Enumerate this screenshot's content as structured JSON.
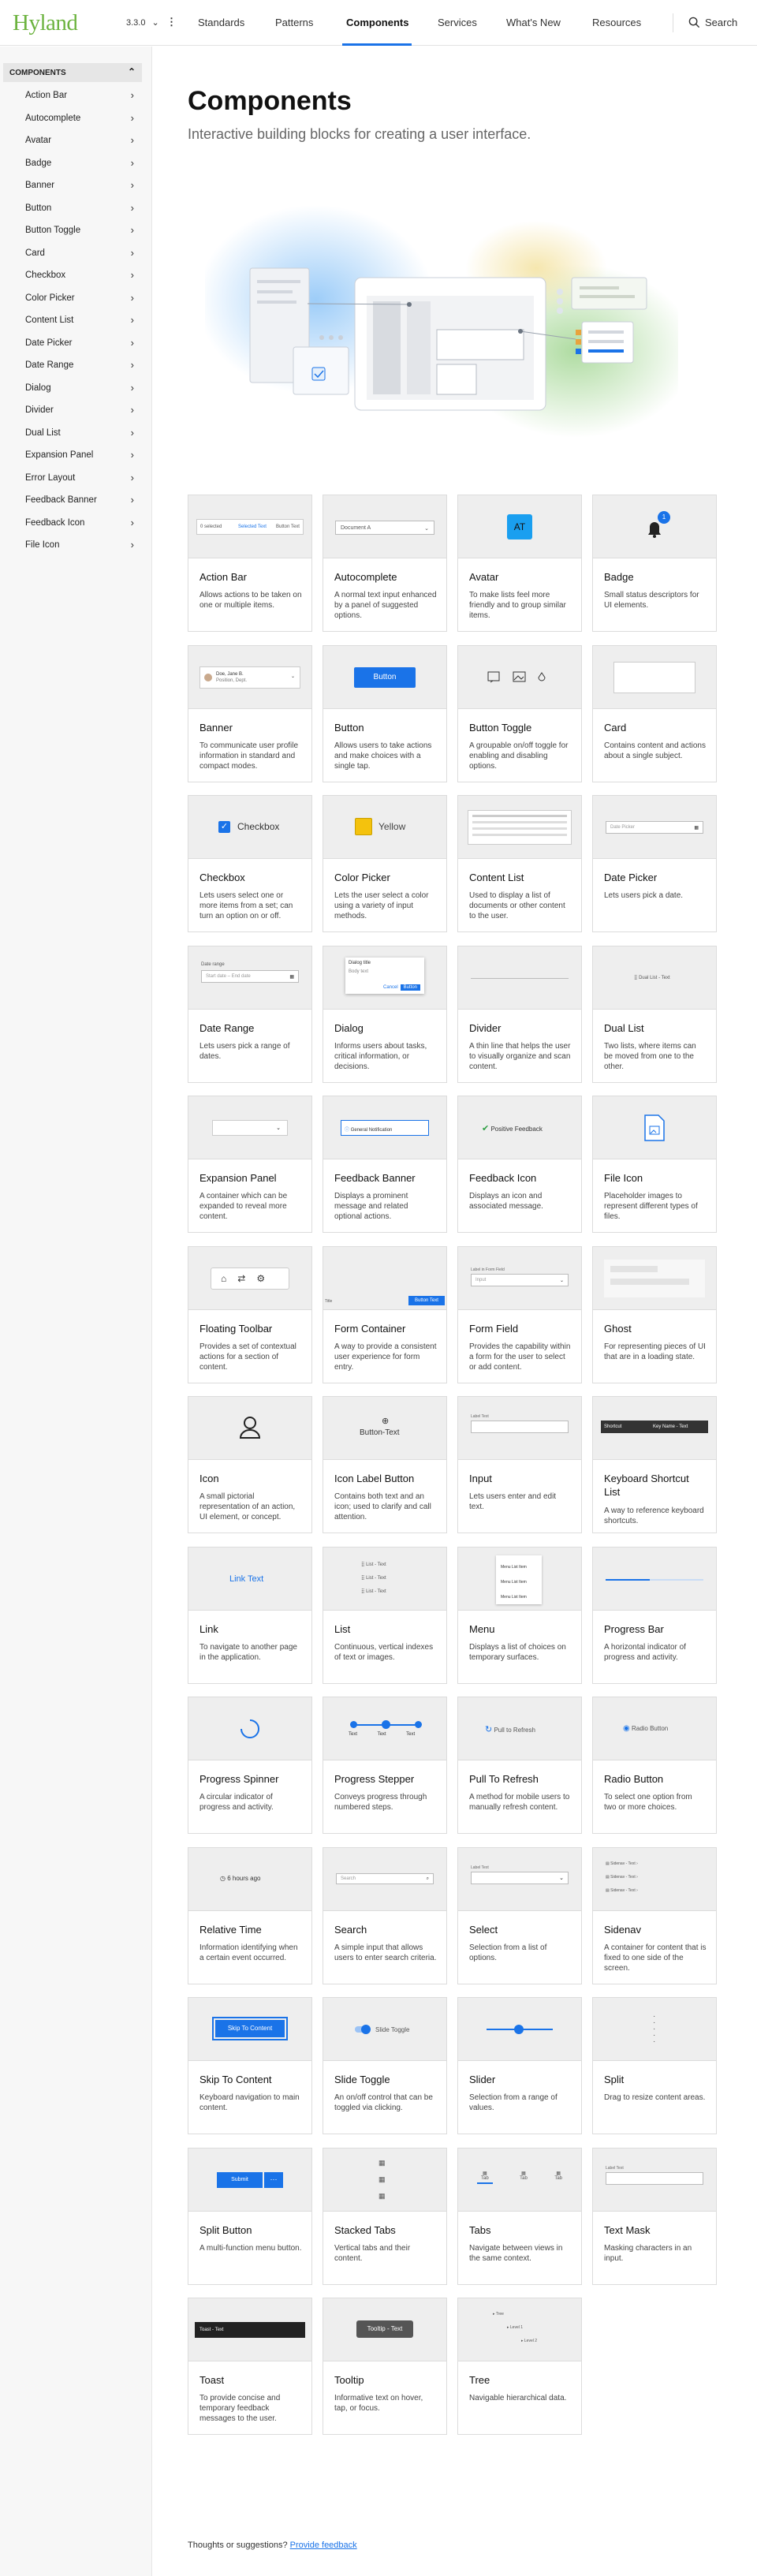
{
  "header": {
    "logo": "Hyland",
    "version": "3.3.0",
    "kebab": "⋮",
    "nav": [
      "Standards",
      "Patterns",
      "Components",
      "Services",
      "What's New",
      "Resources"
    ],
    "search_label": "Search"
  },
  "sidebar": {
    "heading": "COMPONENTS",
    "items": [
      "Action Bar",
      "Autocomplete",
      "Avatar",
      "Badge",
      "Banner",
      "Button",
      "Button Toggle",
      "Card",
      "Checkbox",
      "Color Picker",
      "Content List",
      "Date Picker",
      "Date Range",
      "Dialog",
      "Divider",
      "Dual List",
      "Expansion Panel",
      "Error Layout",
      "Feedback Banner",
      "Feedback Icon",
      "File Icon"
    ]
  },
  "page": {
    "title": "Components",
    "subtitle": "Interactive building blocks for creating a user interface."
  },
  "cards": [
    {
      "title": "Action Bar",
      "desc": "Allows actions to be taken on one or multiple items."
    },
    {
      "title": "Autocomplete",
      "desc": "A normal text input enhanced by a panel of suggested options."
    },
    {
      "title": "Avatar",
      "desc": "To make lists feel more friendly and to group similar items."
    },
    {
      "title": "Badge",
      "desc": "Small status descriptors for UI elements."
    },
    {
      "title": "Banner",
      "desc": "To communicate user profile information in standard and compact modes."
    },
    {
      "title": "Button",
      "desc": "Allows users to take actions and make choices with a single tap."
    },
    {
      "title": "Button Toggle",
      "desc": "A groupable on/off toggle for enabling and disabling options."
    },
    {
      "title": "Card",
      "desc": "Contains content and actions about a single subject."
    },
    {
      "title": "Checkbox",
      "desc": "Lets users select one or more items from a set; can turn an option on or off."
    },
    {
      "title": "Color Picker",
      "desc": "Lets the user select a color using a variety of input methods."
    },
    {
      "title": "Content List",
      "desc": "Used to display a list of documents or other content to the user."
    },
    {
      "title": "Date Picker",
      "desc": "Lets users pick a date."
    },
    {
      "title": "Date Range",
      "desc": "Lets users pick a range of dates."
    },
    {
      "title": "Dialog",
      "desc": "Informs users about tasks, critical information, or decisions."
    },
    {
      "title": "Divider",
      "desc": "A thin line that helps the user to visually organize and scan content."
    },
    {
      "title": "Dual List",
      "desc": "Two lists, where items can be moved from one to the other."
    },
    {
      "title": "Expansion Panel",
      "desc": "A container which can be expanded to reveal more content."
    },
    {
      "title": "Feedback Banner",
      "desc": "Displays a prominent message and related optional actions."
    },
    {
      "title": "Feedback Icon",
      "desc": "Displays an icon and associated message."
    },
    {
      "title": "File Icon",
      "desc": "Placeholder images to represent different types of files."
    },
    {
      "title": "Floating Toolbar",
      "desc": "Provides a set of contextual actions for a section of content."
    },
    {
      "title": "Form Container",
      "desc": "A way to provide a consistent user experience for form entry."
    },
    {
      "title": "Form Field",
      "desc": "Provides the capability within a form for the user to select or add content."
    },
    {
      "title": "Ghost",
      "desc": "For representing pieces of UI that are in a loading state."
    },
    {
      "title": "Icon",
      "desc": "A small pictorial representation of an action, UI element, or concept."
    },
    {
      "title": "Icon Label Button",
      "desc": "Contains both text and an icon; used to clarify and call attention."
    },
    {
      "title": "Input",
      "desc": "Lets users enter and edit text."
    },
    {
      "title": "Keyboard Shortcut List",
      "desc": "A way to reference keyboard shortcuts."
    },
    {
      "title": "Link",
      "desc": "To navigate to another page in the application."
    },
    {
      "title": "List",
      "desc": "Continuous, vertical indexes of text or images."
    },
    {
      "title": "Menu",
      "desc": "Displays a list of choices on temporary surfaces."
    },
    {
      "title": "Progress Bar",
      "desc": "A horizontal indicator of progress and activity."
    },
    {
      "title": "Progress Spinner",
      "desc": "A circular indicator of progress and activity."
    },
    {
      "title": "Progress Stepper",
      "desc": "Conveys progress through numbered steps."
    },
    {
      "title": "Pull To Refresh",
      "desc": "A method for mobile users to manually refresh content."
    },
    {
      "title": "Radio Button",
      "desc": "To select one option from two or more choices."
    },
    {
      "title": "Relative Time",
      "desc": "Information identifying when a certain event occurred."
    },
    {
      "title": "Search",
      "desc": "A simple input that allows users to enter search criteria."
    },
    {
      "title": "Select",
      "desc": "Selection from a list of options."
    },
    {
      "title": "Sidenav",
      "desc": "A container for content that is fixed to one side of the screen."
    },
    {
      "title": "Skip To Content",
      "desc": "Keyboard navigation to main content."
    },
    {
      "title": "Slide Toggle",
      "desc": "An on/off control that can be toggled via clicking."
    },
    {
      "title": "Slider",
      "desc": "Selection from a range of values."
    },
    {
      "title": "Split",
      "desc": "Drag to resize content areas."
    },
    {
      "title": "Split Button",
      "desc": "A multi-function menu button."
    },
    {
      "title": "Stacked Tabs",
      "desc": "Vertical tabs and their content."
    },
    {
      "title": "Tabs",
      "desc": "Navigate between views in the same context."
    },
    {
      "title": "Text Mask",
      "desc": "Masking characters in an input."
    },
    {
      "title": "Toast",
      "desc": "To provide concise and temporary feedback messages to the user."
    },
    {
      "title": "Tooltip",
      "desc": "Informative text on hover, tap, or focus."
    },
    {
      "title": "Tree",
      "desc": "Navigable hierarchical data."
    }
  ],
  "previews": {
    "action_bar": [
      "0 selected",
      "Selected Text",
      "Button Text"
    ],
    "autocomplete": "Document A",
    "avatar": "AT",
    "badge": "1",
    "banner": [
      "Doe, Jane B.",
      "Position, Dept."
    ],
    "button": "Button",
    "checkbox": "Checkbox",
    "color_picker": "Yellow",
    "date_picker": "Date Picker",
    "date_range": [
      "Date range",
      "Start date – End date"
    ],
    "dialog": [
      "Dialog title",
      "Body text",
      "Cancel",
      "Button"
    ],
    "dual_list": "Dual List - Text",
    "feedback_banner": "General Notification",
    "feedback_icon": "Positive Feedback",
    "form_container": [
      "Title",
      "Button Text"
    ],
    "form_field": [
      "Label in Form Field",
      "Input"
    ],
    "icon_label_button": "Button-Text",
    "input": "Label Text",
    "kbd": [
      "Shortcut",
      "Key Name - Text"
    ],
    "link": "Link Text",
    "list": [
      "List - Text",
      "List - Text",
      "List - Text"
    ],
    "menu": [
      "Menu List Item",
      "Menu List Item",
      "Menu List Item"
    ],
    "stepper": [
      "Text",
      "Text",
      "Text"
    ],
    "pull": "Pull to Refresh",
    "radio": "Radio Button",
    "relative_time": "6 hours ago",
    "search": "Search",
    "select": "Label Text",
    "sidenav": [
      "Sidenav - Text",
      "Sidenav - Text",
      "Sidenav - Text"
    ],
    "skip": "Skip To Content",
    "slide_toggle": "Slide Toggle",
    "split_button": "Submit",
    "tabs": [
      "Tab",
      "Tab",
      "Tab"
    ],
    "text_mask": "Label Text",
    "toast": "Toast - Text",
    "tooltip": "Tooltip - Text",
    "tree": [
      "Tree",
      "Level 1",
      "Level 2"
    ]
  },
  "footer": {
    "prompt": "Thoughts or suggestions?",
    "link": "Provide feedback"
  }
}
